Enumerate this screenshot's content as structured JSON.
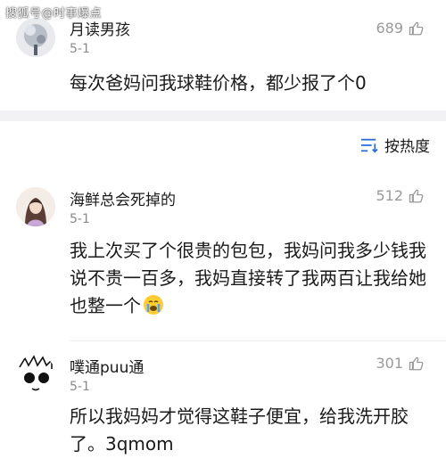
{
  "watermark": "搜狐号@时事爆点",
  "comments": [
    {
      "username": "月读男孩",
      "date": "5-1",
      "likes": "689",
      "text": "每次爸妈问我球鞋价格，都少报了个0"
    },
    {
      "username": "海鲜总会死掉的",
      "date": "5-1",
      "likes": "512",
      "text": "我上次买了个很贵的包包，我妈问我多少钱我说不贵一百多，我妈直接转了我两百让我给她也整一个"
    },
    {
      "username": "噗通puu通",
      "date": "5-1",
      "likes": "301",
      "text": "所以我妈妈才觉得这鞋子便宜，给我洗开胶了。3qmom"
    }
  ],
  "sort": {
    "label": "按热度"
  },
  "colors": {
    "band": "#f2f2f4",
    "muted": "#8a8a8a",
    "text": "#1a1a1a"
  }
}
